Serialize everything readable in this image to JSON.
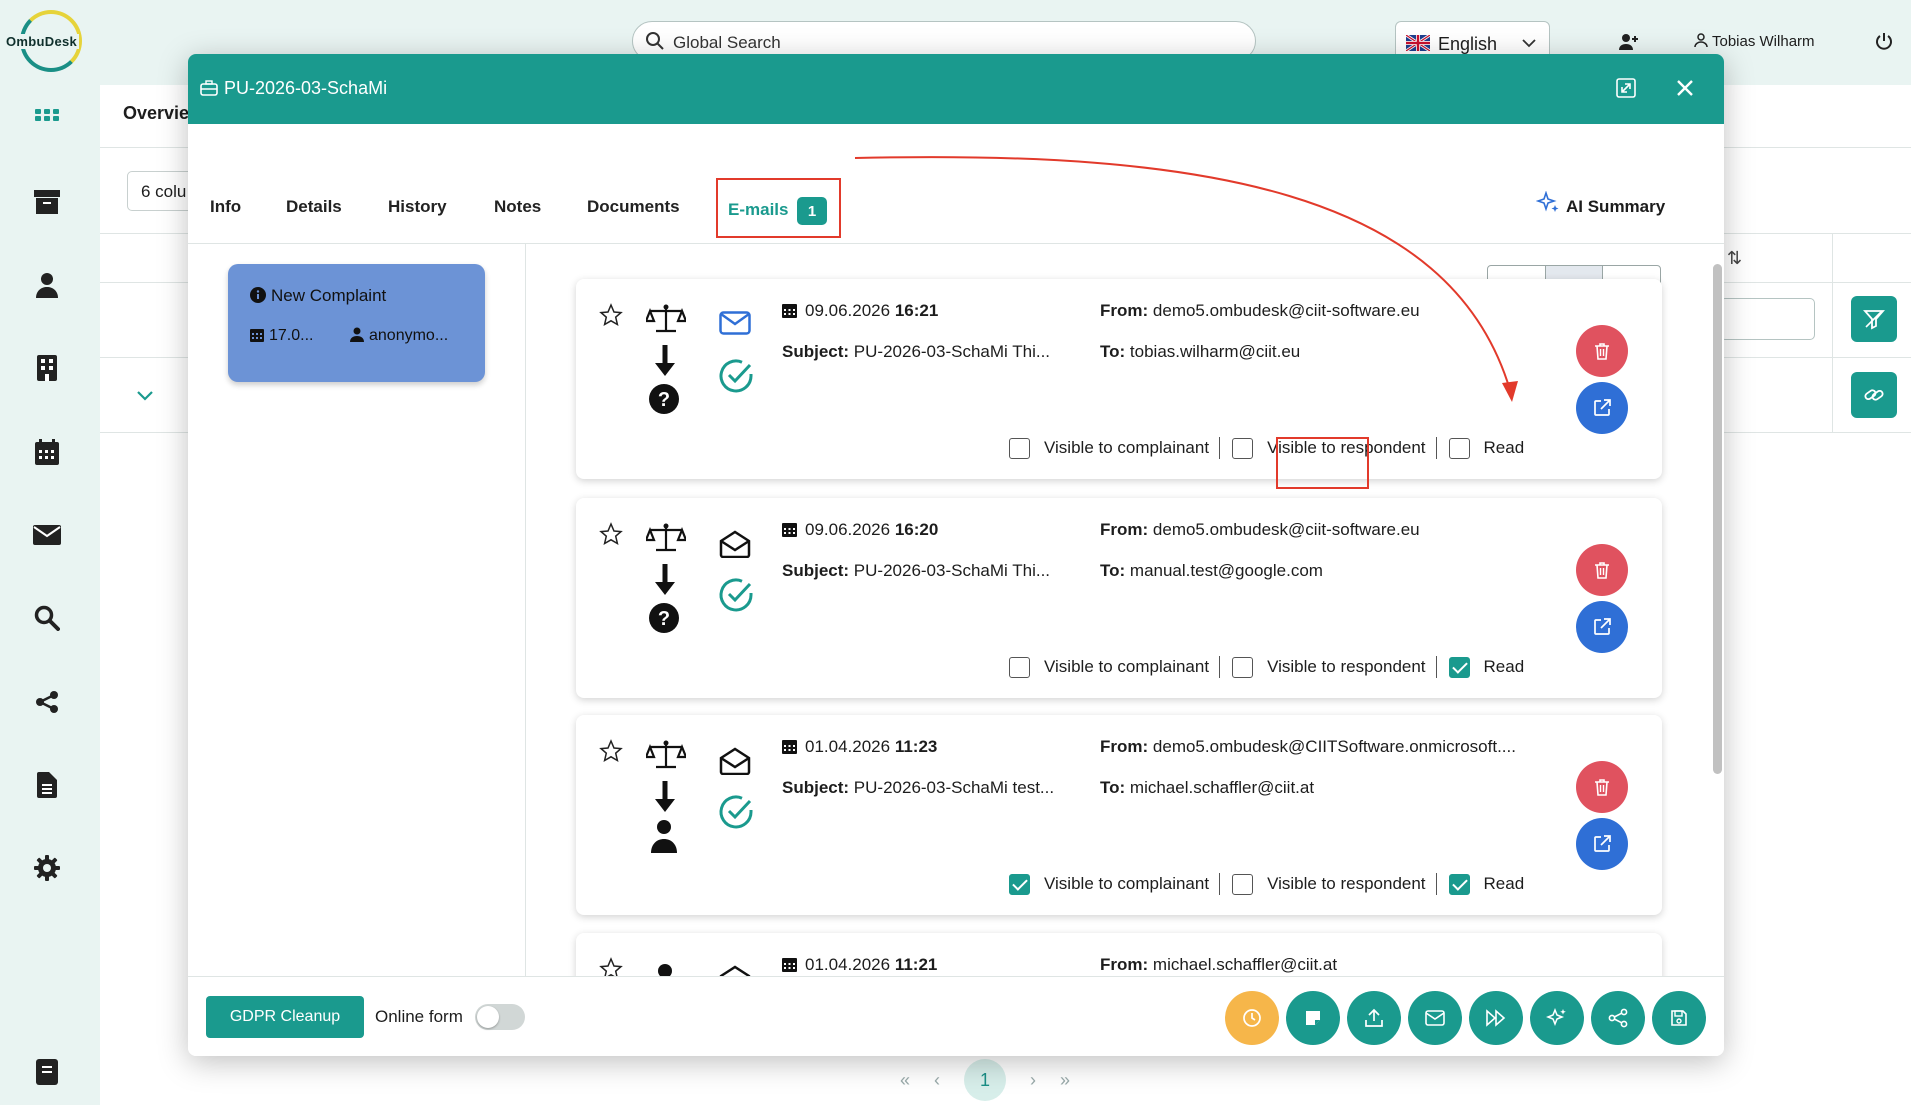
{
  "app": {
    "logo_text": "OmbuDesk"
  },
  "topbar": {
    "search_placeholder": "Global Search",
    "language": "English",
    "user_name": "Tobias Wilharm"
  },
  "background": {
    "overview_label": "Overvie",
    "columns_label": "6 colu",
    "current_page": "1",
    "pager": {
      "first": "«",
      "prev": "‹",
      "next": "›",
      "last": "»"
    }
  },
  "modal": {
    "title": "PU-2026-03-SchaMi",
    "tabs": [
      "Info",
      "Details",
      "History",
      "Notes",
      "Documents"
    ],
    "emails_tab": {
      "label": "E-mails",
      "count": "1"
    },
    "ai_summary": "AI Summary",
    "case_card": {
      "title": "New Complaint",
      "date": "17.0...",
      "user": "anonymo..."
    },
    "emails": [
      {
        "date": "09.06.2026",
        "time": "16:21",
        "subject_label": "Subject:",
        "subject": "PU-2026-03-SchaMi Thi...",
        "from_label": "From:",
        "from": "demo5.ombudesk@ciit-software.eu",
        "to_label": "To:",
        "to": "tobias.wilharm@ciit.eu",
        "visible_complainant": false,
        "visible_respondent": false,
        "read": false
      },
      {
        "date": "09.06.2026",
        "time": "16:20",
        "subject_label": "Subject:",
        "subject": "PU-2026-03-SchaMi Thi...",
        "from_label": "From:",
        "from": "demo5.ombudesk@ciit-software.eu",
        "to_label": "To:",
        "to": "manual.test@google.com",
        "visible_complainant": false,
        "visible_respondent": false,
        "read": true
      },
      {
        "date": "01.04.2026",
        "time": "11:23",
        "subject_label": "Subject:",
        "subject": "PU-2026-03-SchaMi test...",
        "from_label": "From:",
        "from": "demo5.ombudesk@CIITSoftware.onmicrosoft....",
        "to_label": "To:",
        "to": "michael.schaffler@ciit.at",
        "visible_complainant": true,
        "visible_respondent": false,
        "read": true
      },
      {
        "date": "01.04.2026",
        "time": "11:21",
        "from_label": "From:",
        "from": "michael.schaffler@ciit.at"
      }
    ],
    "option_labels": {
      "complainant": "Visible to complainant",
      "respondent": "Visible to respondent",
      "read": "Read"
    },
    "footer": {
      "gdpr": "GDPR Cleanup",
      "online_form": "Online form"
    }
  },
  "colors": {
    "primary": "#1a9a8e",
    "delete": "#e0525f",
    "open": "#2f6fd6",
    "annotation": "#e23a2b",
    "case_card": "#6c93d6"
  }
}
